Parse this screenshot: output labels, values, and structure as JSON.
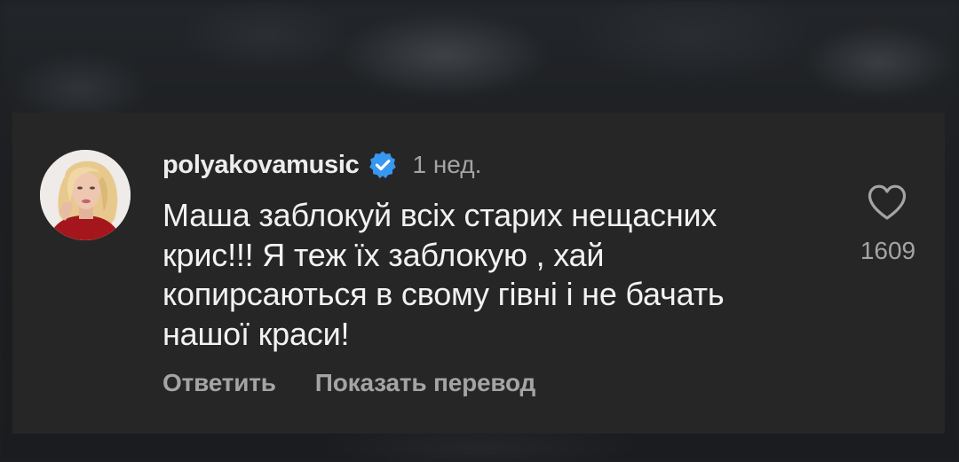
{
  "comment": {
    "username": "polyakovamusic",
    "verified_icon": "verified-badge-icon",
    "time_ago": "1 нед.",
    "text": "Маша заблокуй всіх старих нещасних\nкрис!!! Я теж їх заблокую , хай\nкопирсаються  в свому гівні і не бачать\nнашої краси!",
    "like_icon": "heart-outline-icon",
    "like_count": "1609",
    "reply_label": "Ответить",
    "translate_label": "Показать перевод"
  },
  "colors": {
    "panel_background": "#262626",
    "primary_text": "#f2f2f2",
    "secondary_text": "#a4a4a4",
    "verified_blue": "#3897f0"
  }
}
